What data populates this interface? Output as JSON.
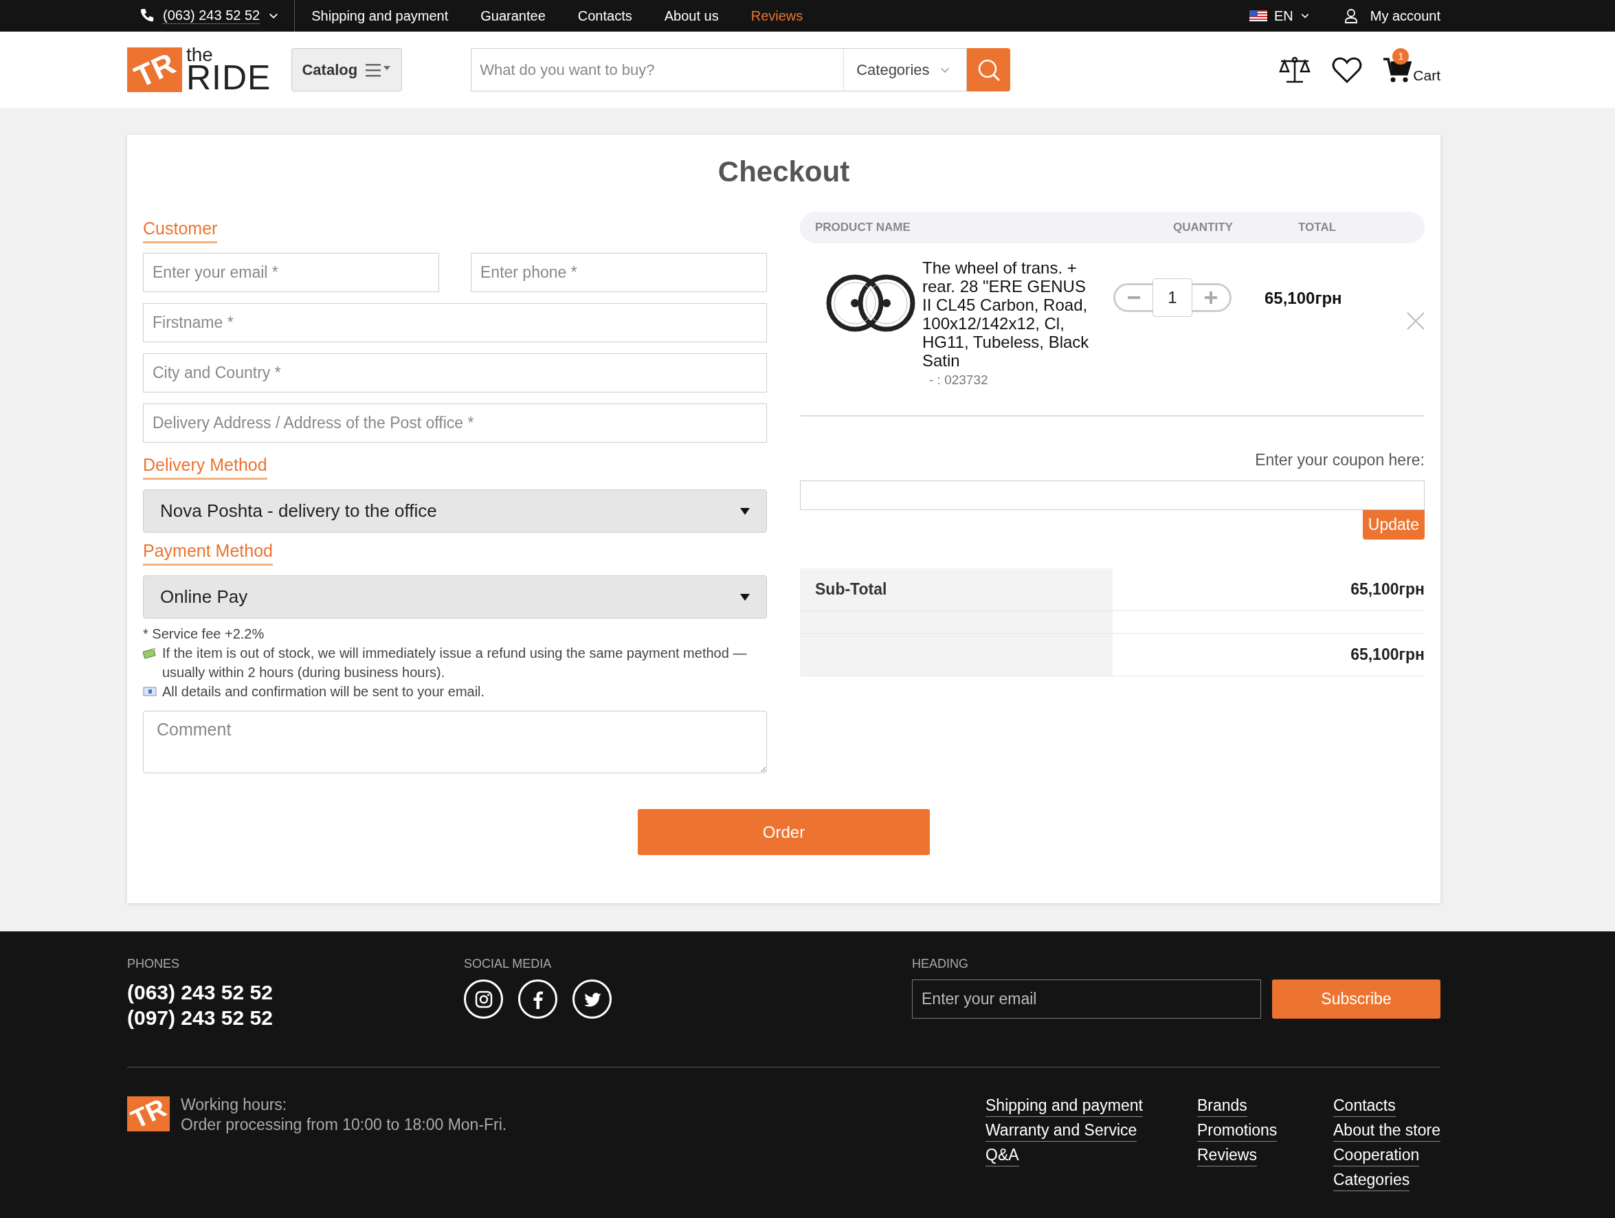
{
  "top_bar": {
    "phone": "(063) 243 52 52",
    "nav": [
      {
        "label": "Shipping and payment",
        "selected": false
      },
      {
        "label": "Guarantee",
        "selected": false
      },
      {
        "label": "Contacts",
        "selected": false
      },
      {
        "label": "About us",
        "selected": false
      },
      {
        "label": "Reviews",
        "selected": true
      }
    ],
    "language": "EN",
    "account": "My account"
  },
  "header": {
    "logo": {
      "mark": "TR",
      "small": "the",
      "big": "RIDE"
    },
    "catalog": "Catalog",
    "search": {
      "placeholder": "What do you want to buy?"
    },
    "categories": "Categories",
    "cart": {
      "label": "Cart",
      "count": "1"
    }
  },
  "checkout": {
    "title": "Checkout",
    "customer": {
      "heading": "Customer",
      "fields": [
        {
          "kind": "half",
          "placeholder": "Enter your email *"
        },
        {
          "kind": "half",
          "placeholder": "Enter phone *"
        },
        {
          "kind": "full",
          "placeholder": "Firstname *"
        },
        {
          "kind": "full",
          "placeholder": "City and Country *"
        },
        {
          "kind": "full",
          "placeholder": "Delivery Address / Address of the Post office *"
        }
      ]
    },
    "delivery": {
      "heading": "Delivery Method",
      "value": "Nova Poshta - delivery to the office"
    },
    "payment": {
      "heading": "Payment Method",
      "value": "Online Pay"
    },
    "notes": [
      {
        "kind": "plain",
        "text": "* Service fee +2.2%"
      },
      {
        "kind": "money",
        "text": "If the item is out of stock, we will immediately issue a refund using the same payment method — usually within 2 hours (during business hours)."
      },
      {
        "kind": "envelope",
        "text": "All details and confirmation will be sent to your email."
      }
    ],
    "comment": {
      "placeholder": "Comment"
    },
    "order_button": "Order",
    "cart": {
      "columns": [
        "PRODUCT NAME",
        "QUANTITY",
        "TOTAL"
      ],
      "items": [
        {
          "name": "The wheel of trans. + rear. 28 \"ERE GENUS II CL45 Carbon, Road, 100x12/142x12, Cl, HG11, Tubeless, Black Satin",
          "sku": "- : 023732",
          "quantity": "1",
          "total": "65,100грн"
        }
      ],
      "coupon": {
        "label": "Enter your coupon here:",
        "button": "Update"
      },
      "totals": [
        {
          "label": "Sub-Total",
          "value": "65,100грн"
        },
        {
          "value": "65,100грн"
        }
      ]
    }
  },
  "footer": {
    "phones": {
      "heading": "PHONES",
      "numbers": [
        "(063) 243 52 52",
        "(097) 243 52 52"
      ]
    },
    "social": {
      "heading": "SOCIAL MEDIA",
      "networks": [
        {
          "kind": "instagram"
        },
        {
          "kind": "facebook"
        },
        {
          "kind": "twitter"
        }
      ]
    },
    "newsletter": {
      "heading": "HEADING",
      "placeholder": "Enter your email",
      "button": "Subscribe"
    },
    "logo_mark": "TR",
    "hours": {
      "title": "Working hours:",
      "text": "Order processing from 10:00 to 18:00 Mon-Fri."
    },
    "link_columns": [
      [
        "Shipping and payment",
        "Warranty and Service",
        "Q&A"
      ],
      [
        "Brands",
        "Promotions",
        "Reviews"
      ],
      [
        "Contacts",
        "About the store",
        "Cooperation",
        "Categories"
      ]
    ]
  }
}
